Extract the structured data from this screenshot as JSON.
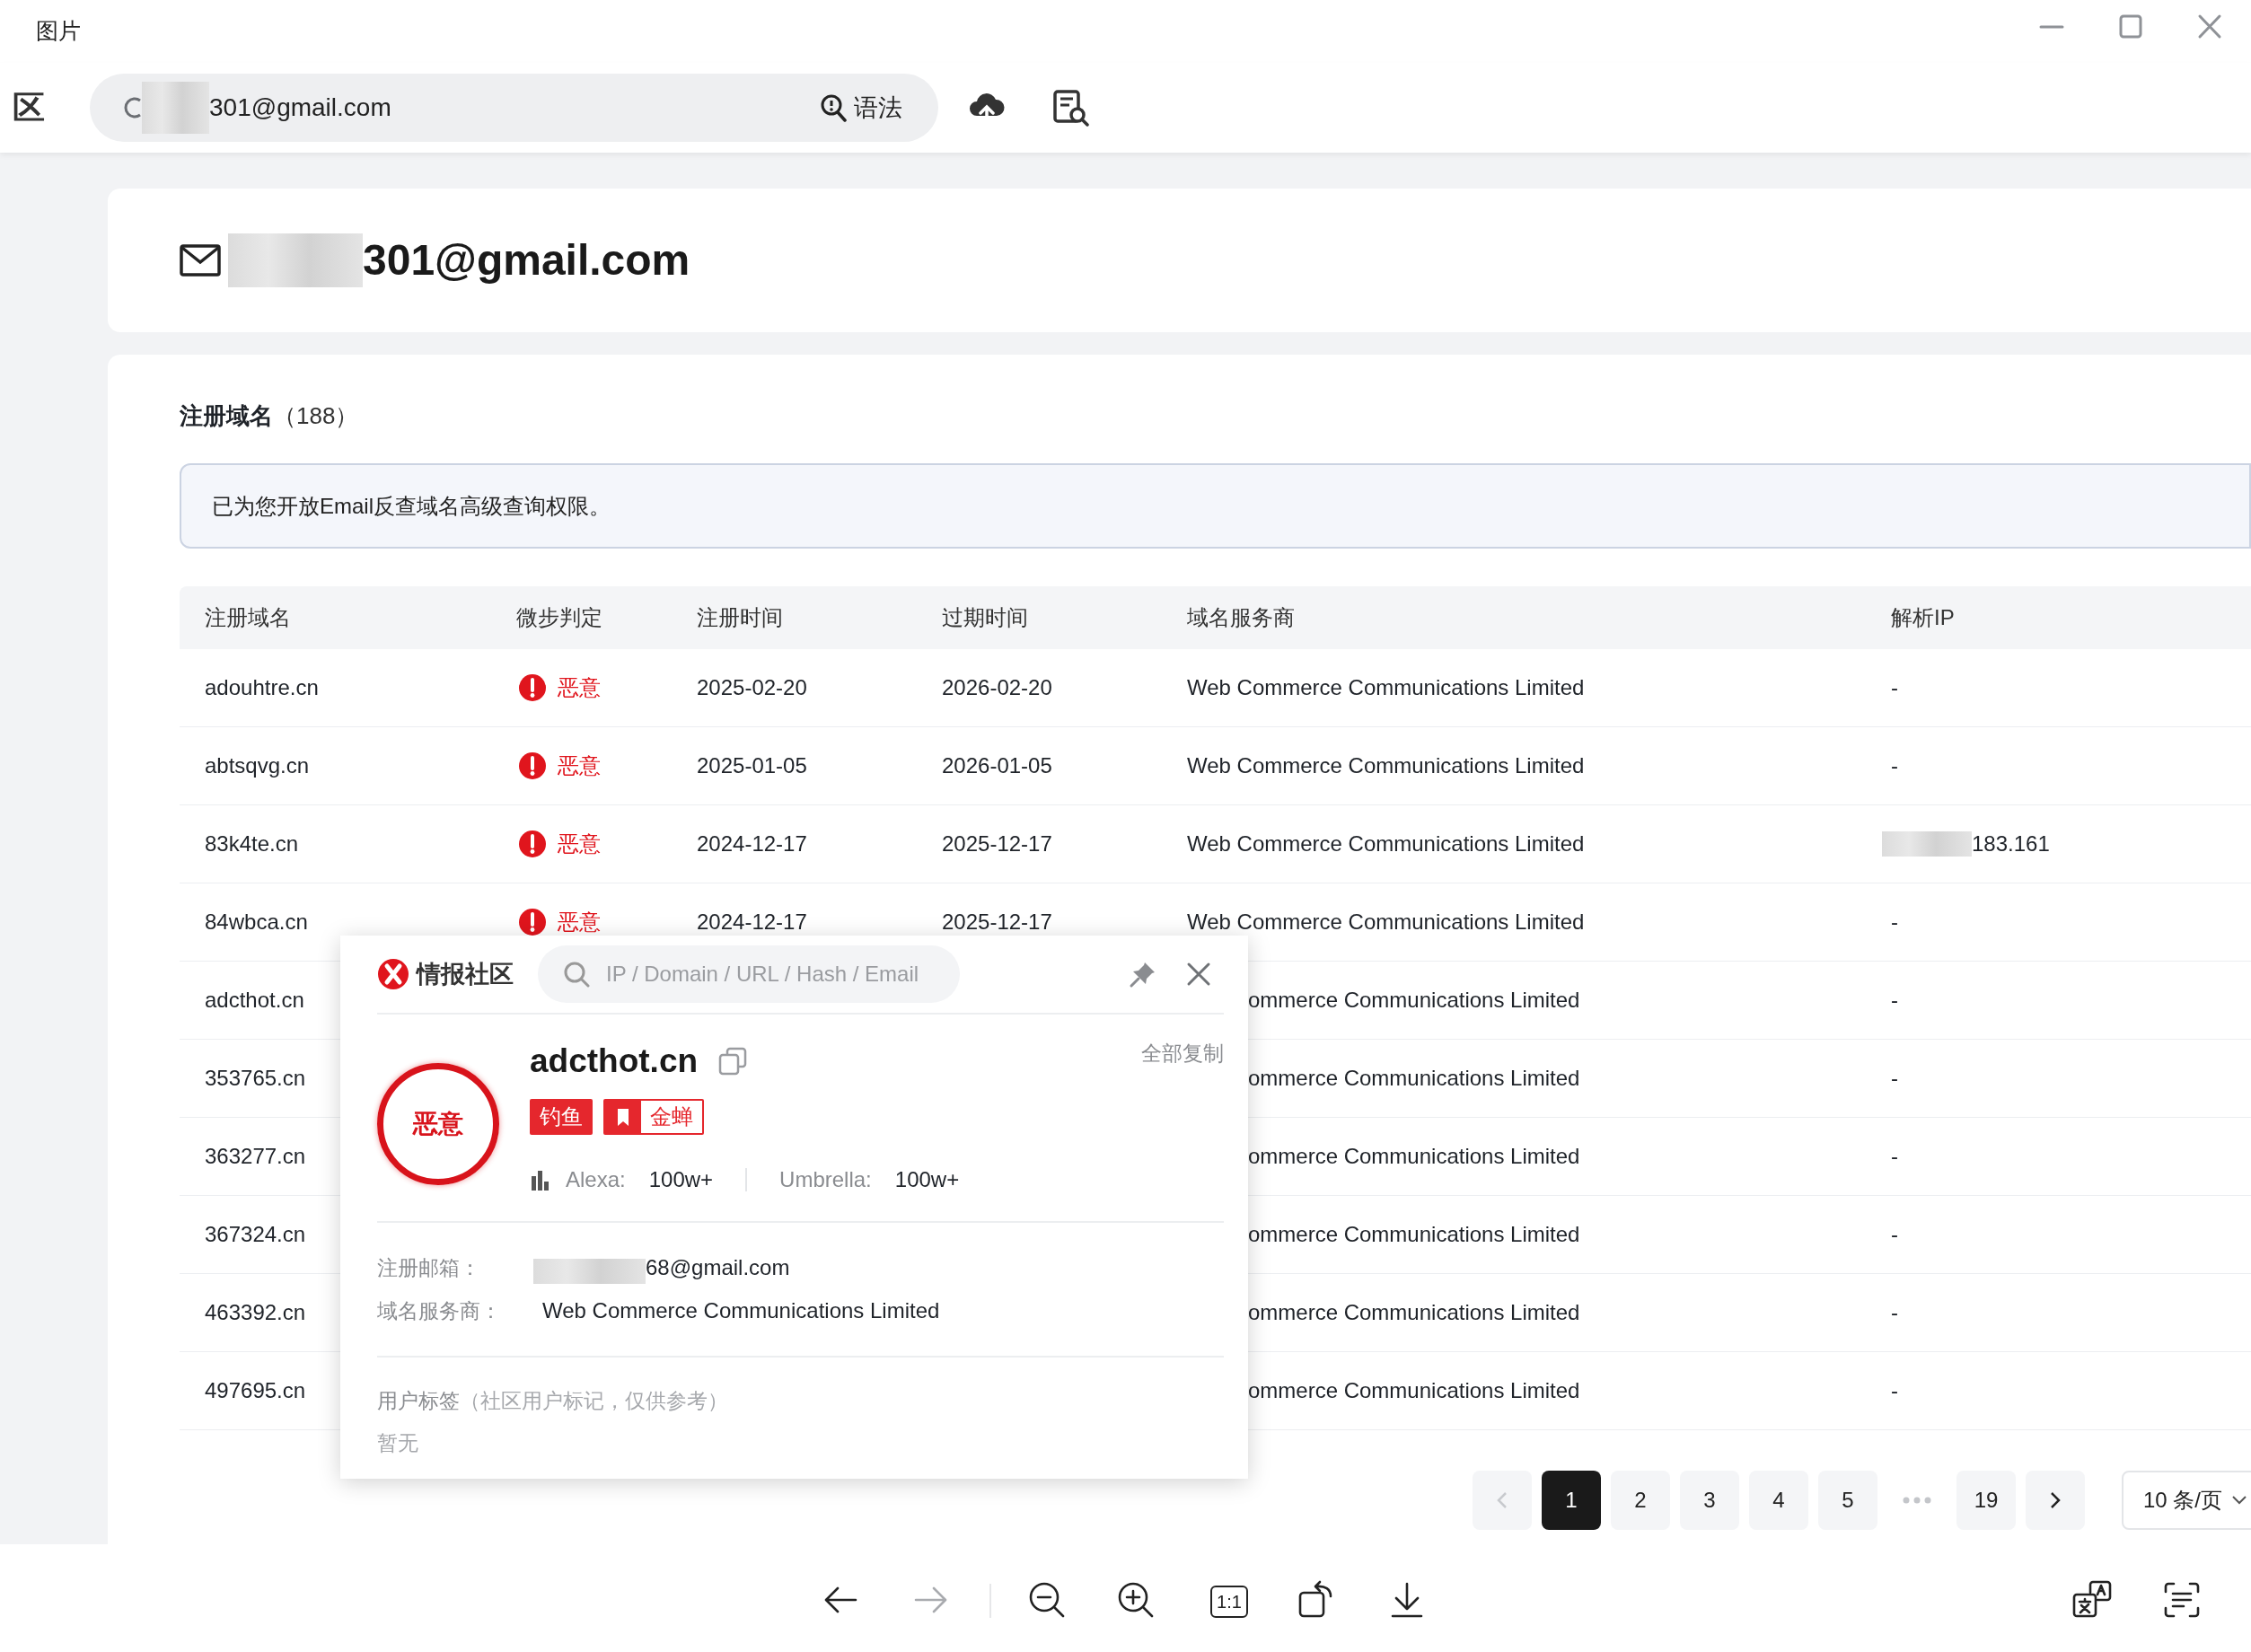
{
  "window": {
    "title": "图片"
  },
  "app_bar": {
    "brand": "区",
    "search_value": "301@gmail.com",
    "search_redacted": true,
    "syntax_button": "语法"
  },
  "email_card": {
    "email": "301@gmail.com",
    "redacted": true
  },
  "domains": {
    "title": "注册域名",
    "count": "（188）",
    "notice": "已为您开放Email反查域名高级查询权限。",
    "columns": [
      "注册域名",
      "微步判定",
      "注册时间",
      "过期时间",
      "域名服务商",
      "解析IP"
    ],
    "rows": [
      {
        "domain": "adouhtre.cn",
        "verdict": "恶意",
        "registered": "2025-02-20",
        "expires": "2026-02-20",
        "registrar": "Web Commerce Communications Limited",
        "ip": "-"
      },
      {
        "domain": "abtsqvg.cn",
        "verdict": "恶意",
        "registered": "2025-01-05",
        "expires": "2026-01-05",
        "registrar": "Web Commerce Communications Limited",
        "ip": "-"
      },
      {
        "domain": "83k4te.cn",
        "verdict": "恶意",
        "registered": "2024-12-17",
        "expires": "2025-12-17",
        "registrar": "Web Commerce Communications Limited",
        "ip": "183.161",
        "ip_redacted": true
      },
      {
        "domain": "84wbca.cn",
        "verdict": "恶意",
        "registered": "2024-12-17",
        "expires": "2025-12-17",
        "registrar": "Web Commerce Communications Limited",
        "ip": "-"
      },
      {
        "domain": "adcthot.cn",
        "registrar": "ommerce Communications Limited",
        "ip": "-"
      },
      {
        "domain": "353765.cn",
        "registrar": "ommerce Communications Limited",
        "ip": "-"
      },
      {
        "domain": "363277.cn",
        "registrar": "ommerce Communications Limited",
        "ip": "-"
      },
      {
        "domain": "367324.cn",
        "registrar": "ommerce Communications Limited",
        "ip": "-"
      },
      {
        "domain": "463392.cn",
        "registrar": "ommerce Communications Limited",
        "ip": "-"
      },
      {
        "domain": "497695.cn",
        "registrar": "ommerce Communications Limited",
        "ip": "-"
      }
    ]
  },
  "pagination": {
    "items": [
      {
        "kind": "prev",
        "disabled": true
      },
      {
        "kind": "page",
        "label": "1",
        "selected": true
      },
      {
        "kind": "page",
        "label": "2",
        "selected": false
      },
      {
        "kind": "page",
        "label": "3",
        "selected": false
      },
      {
        "kind": "page",
        "label": "4",
        "selected": false
      },
      {
        "kind": "page",
        "label": "5",
        "selected": false
      },
      {
        "kind": "ellipsis"
      },
      {
        "kind": "page",
        "label": "19",
        "selected": false
      },
      {
        "kind": "next",
        "disabled": false
      }
    ],
    "page_size": "10 条/页"
  },
  "popup": {
    "brand": "情报社区",
    "search_placeholder": "IP / Domain / URL / Hash / Email",
    "domain": "adcthot.cn",
    "copy_all": "全部复制",
    "verdict": "恶意",
    "tags": [
      {
        "kind": "solid",
        "label": "钓鱼"
      },
      {
        "kind": "bookmark",
        "label": "金蝉"
      }
    ],
    "ranks": [
      {
        "label": "Alexa:",
        "value": "100w+"
      },
      {
        "label": "Umbrella:",
        "value": "100w+"
      }
    ],
    "fields": [
      {
        "label": "注册邮箱：",
        "value": "68@gmail.com",
        "redacted": true
      },
      {
        "label": "域名服务商：",
        "value": "Web Commerce Communications Limited"
      }
    ],
    "user_tags": {
      "title": "用户标签",
      "hint": "（社区用户标记，仅供参考）",
      "value": "暂无"
    }
  },
  "toolbar": {
    "forward_disabled": true,
    "actual_size": "1:1"
  }
}
